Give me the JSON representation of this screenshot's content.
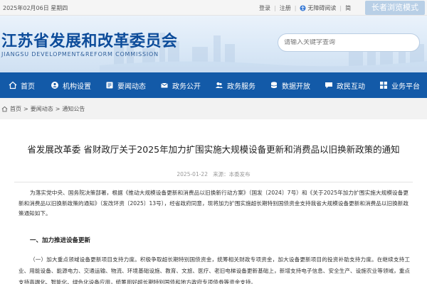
{
  "topbar": {
    "date": "2025年02月06日 星期四",
    "login": "登录",
    "separator": "|",
    "register": "注册",
    "barrier_free": "无障碍阅读",
    "simplified": "简",
    "elder_mode": "长者浏览模式"
  },
  "header": {
    "title": "江苏省发展和改革委员会",
    "subtitle": "JIANGSU DEVELOPMENT&REFORM COMMISSION",
    "search_placeholder": "请输入关键字查询"
  },
  "nav": [
    {
      "label": "首页",
      "icon": "home-icon"
    },
    {
      "label": "机构设置",
      "icon": "org-icon"
    },
    {
      "label": "要闻动态",
      "icon": "news-icon"
    },
    {
      "label": "政务公开",
      "icon": "open-icon"
    },
    {
      "label": "政务服务",
      "icon": "service-icon"
    },
    {
      "label": "数据开放",
      "icon": "data-icon"
    },
    {
      "label": "政民互动",
      "icon": "interact-icon"
    },
    {
      "label": "业务平台",
      "icon": "platform-icon"
    }
  ],
  "breadcrumb": {
    "items": [
      "首页",
      "要闻动态",
      "通知公告"
    ],
    "sep": ">"
  },
  "article": {
    "title": "省发展改革委  省财政厅关于2025年加力扩围实施大规模设备更新和消费品以旧换新政策的通知",
    "date": "2025-01-22",
    "source": "来源：本委发布",
    "paragraph1": "为落实党中央、国务院决策部署，根据《推动大规模设备更新和消费品以旧换新行动方案》（国发〔2024〕7号）和《关于2025年加力扩围实施大规模设备更新和消费品以旧换新政策的通知》（发改环资〔2025〕13号），经省政府同意，现将加力扩围实施超长期特别国债资金支持我省大规模设备更新和消费品以旧换新政策通知如下。",
    "section1": "一、加力推进设备更新",
    "paragraph2": "（一）加大重点领域设备更新项目支持力度。积极争取超长期特别国债资金，统筹相关财政专项资金，加大设备更新项目的投资补助支持力度。在继续支持工业、用能设备、能源电力、交通运输、物流、环境基础设施、教育、文旅、医疗、老旧电梯设备更新基础上，新增支持电子信息、安全生产、设施农业等领域，重点支持高端化、智能化、绿色化设备应用，统筹用好超长期特别国债和地方政府专项债券等资金支持。"
  }
}
